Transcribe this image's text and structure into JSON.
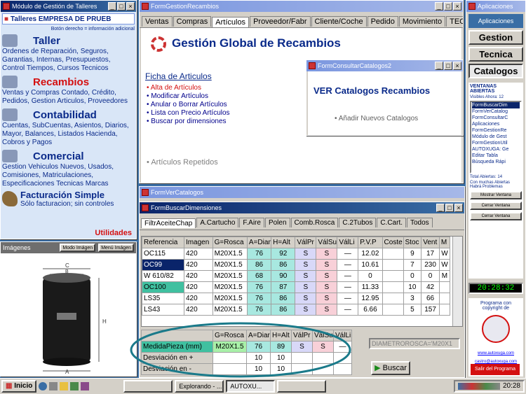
{
  "left": {
    "title": "Módulo de Gestión de Talleres",
    "app_name": "Talleres EMPRESA DE PRUEB",
    "hint": "Botón derecho = información adicional",
    "sections": [
      {
        "title": "Taller",
        "body": "Ordenes de Reparación, Seguros, Garantias, Internas, Presupuestos, Control Tiempos, Cursos Tecnicos",
        "color": "#0a2a8a"
      },
      {
        "title": "Recambios",
        "body": "Ventas y Compras Contado, Crédito, Pedidos, Gestion Articulos, Proveedores",
        "color": "#d41010"
      },
      {
        "title": "Contabilidad",
        "body": "Cuentas, SubCuentas, Asientos, Diarios, Mayor, Balances, Listados Hacienda, Cobros y Pagos",
        "color": "#0a2a8a"
      },
      {
        "title": "Comercial",
        "body": "Gestion Vehiculos Nuevos, Usados, Comisiones, Matriculaciones, Especificaciones Tecnicas Marcas",
        "color": "#0a2a8a"
      }
    ],
    "fact_title": "Facturación Simple",
    "fact_sub": "Sólo facturacion; sin controles",
    "utilidades": "Utilidades",
    "img_label": "Imágenes",
    "mode_btn": "Modo Imágen",
    "menu_btn": "Menú Imágen"
  },
  "gestion": {
    "title": "FormGestionRecambios",
    "tabs": [
      "Ventas",
      "Compras",
      "Artículos",
      "Proveedor/Fabr",
      "Cliente/Coche",
      "Pedido",
      "Movimiento",
      "TECNIC"
    ],
    "heading": "Gestión Global de Recambios",
    "sub": "Ficha de Articulos",
    "items": [
      "Alta de Artículos",
      "Modificar Artículos",
      "Anular o Borrar Artículos",
      "Lista con Precio Artículos",
      "Buscar por dimensiones"
    ],
    "repeated": "Artículos Repetidos"
  },
  "catalogos": {
    "title": "FormConsultarCatalogos2",
    "heading": "VER Catalogos Recambios",
    "item": "Añadir Nuevos Catalogos"
  },
  "vercat": {
    "title": "FormVerCatalogos"
  },
  "buscar": {
    "title": "FormBuscarDimensiones",
    "tabs": [
      "FiltrAceiteChap",
      "A.Cartucho",
      "F.Aire",
      "Polen",
      "Comb.Rosca",
      "C.2Tubos",
      "C.Cart.",
      "Todos"
    ],
    "headers": [
      "Referencia",
      "Imagen",
      "G=Rosca",
      "A=Diam",
      "H=Alt",
      "VálPr",
      "VálSu",
      "VálLi",
      "P.V.P",
      "Coste",
      "Stoc",
      "Vent",
      "M"
    ],
    "rows": [
      [
        "OC115",
        "420",
        "M20X1.5",
        "76",
        "92",
        "S",
        "S",
        "—",
        "12.02",
        "",
        "9",
        "17",
        "W"
      ],
      [
        "OC99",
        "420",
        "M20X1.5",
        "86",
        "86",
        "S",
        "S",
        "—",
        "10.61",
        "",
        "7",
        "230",
        "W"
      ],
      [
        "W 610/82",
        "420",
        "M20X1.5",
        "68",
        "90",
        "S",
        "S",
        "—",
        "0",
        "",
        "0",
        "0",
        "M"
      ],
      [
        "OC100",
        "420",
        "M20X1.5",
        "76",
        "87",
        "S",
        "S",
        "—",
        "11.33",
        "",
        "10",
        "42",
        ""
      ],
      [
        "LS35",
        "420",
        "M20X1.5",
        "76",
        "86",
        "S",
        "S",
        "—",
        "12.95",
        "",
        "3",
        "66",
        ""
      ],
      [
        "LS43",
        "420",
        "M20X1.5",
        "76",
        "86",
        "S",
        "S",
        "—",
        "6.66",
        "",
        "5",
        "157",
        ""
      ]
    ],
    "sub_headers": [
      "G=Rosca",
      "A=Diar",
      "H=Alt",
      "VálPr",
      "VálSu",
      "VálLi"
    ],
    "sub_rows": [
      {
        "label": "MedidaPieza (mm)",
        "vals": [
          "M20X1.5",
          "76",
          "89",
          "S",
          "S",
          "—"
        ]
      },
      {
        "label": "Desviación en +",
        "vals": [
          "",
          "10",
          "10",
          "",
          "",
          ""
        ]
      },
      {
        "label": "Desviación en -",
        "vals": [
          "",
          "10",
          "10",
          "",
          "",
          ""
        ]
      }
    ],
    "filter": "DIAMETROROSCA='M20X1",
    "search_btn": "Buscar"
  },
  "right": {
    "title": "Aplicaciones",
    "app_btn": "Aplicaciones",
    "buttons": [
      "Gestion",
      "Tecnica",
      "Catalogos"
    ],
    "open_title": "VENTANAS ABIERTAS",
    "visible": "Visibles Ahora: 12",
    "windows": [
      "FormBuscarDim",
      "FormVerCatalog",
      "FormConsultarC",
      "Aplicaciones",
      "FormGestionRe",
      "Módulo de Gest",
      "FormGestionUtil",
      "AUTOXUGA: Ge",
      "Editar Tabla",
      "Búsqueda Rápi"
    ],
    "total": "Total Abiertas: 14",
    "warn": "Con muchas Abiertas Habrá Problemas",
    "win_btns": [
      "Mostrar Ventana",
      "Cerrar Ventana",
      "Cerrar Ventana"
    ],
    "clock": "20:28:32",
    "copyright": "Programa con copyright de",
    "link1": "www.autoxuga.com",
    "link2": "castro@autoxuga.com",
    "exit": "Salir del Programa"
  },
  "taskbar": {
    "start": "Inicio",
    "tasks": [
      "",
      "Explorando - ...",
      "AUTOXU...",
      ""
    ],
    "time": "20:28"
  }
}
